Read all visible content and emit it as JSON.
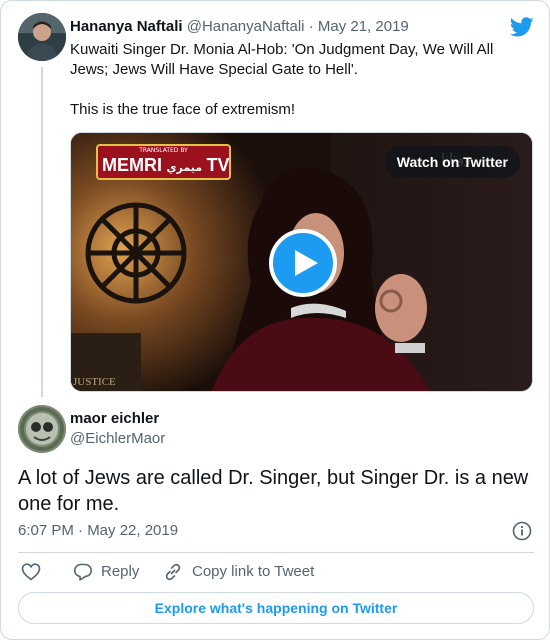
{
  "quoted_tweet": {
    "author_name": "Hananya Naftali",
    "handle": "@HananyaNaftali",
    "separator": "·",
    "date": "May 21, 2019",
    "text_line1": "Kuwaiti Singer Dr. Monia Al-Hob: 'On Judgment Day, We Will All Jews; Jews Will Have Special Gate to Hell'.",
    "text_line2": "This is the true face of extremism!",
    "media": {
      "logo_top": "TRANSLATED BY",
      "logo_main": "MEMRI",
      "logo_arabic": "ميمري",
      "logo_tv": "TV",
      "watch_label": "Watch on Twitter",
      "watermark": "JUSTICE"
    }
  },
  "tweet": {
    "author_name": "maor eichler",
    "handle": "@EichlerMaor",
    "text": "A lot of Jews are called Dr. Singer, but Singer Dr. is a new one for me.",
    "timestamp": "6:07 PM · May 22, 2019"
  },
  "actions": {
    "reply_label": "Reply",
    "copy_label": "Copy link to Tweet"
  },
  "explore_label": "Explore what's happening on Twitter",
  "colors": {
    "accent": "#1d9bf0",
    "text_primary": "#0f1419",
    "text_secondary": "#536471",
    "border": "#cfd9de"
  },
  "icons": [
    "twitter-bird-icon",
    "info-icon",
    "heart-icon",
    "reply-icon",
    "link-icon",
    "play-icon"
  ]
}
